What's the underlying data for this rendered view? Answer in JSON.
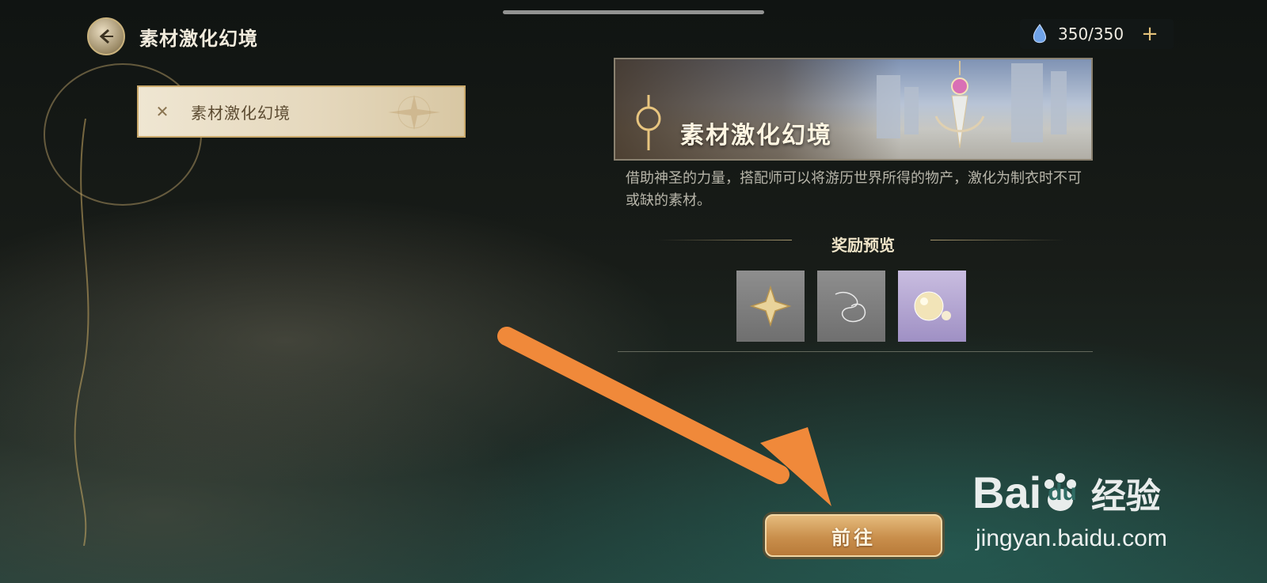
{
  "header": {
    "title": "素材激化幻境",
    "stamina": "350/350",
    "stamina_plus": "+"
  },
  "sidebar": {
    "items": [
      {
        "label": "素材激化幻境",
        "selected": true
      }
    ]
  },
  "detail": {
    "banner_title": "素材激化幻境",
    "description": "借助神圣的力量，搭配师可以将游历世界所得的物产，激化为制衣时不可或缺的素材。",
    "reward_section_title": "奖励预览",
    "rewards": [
      {
        "icon": "gold-star-crystal-icon",
        "rarity": "gray"
      },
      {
        "icon": "silver-thread-icon",
        "rarity": "gray"
      },
      {
        "icon": "pearl-icon",
        "rarity": "purple"
      }
    ],
    "go_button": "前往"
  },
  "watermark": {
    "logo_text": "Bai",
    "logo_text_b": "du",
    "logo_cn": "经验",
    "url": "jingyan.baidu.com"
  },
  "colors": {
    "accent_gold": "#c9b27d",
    "button": "#c98f4c",
    "annotation_arrow": "#f0893a"
  }
}
